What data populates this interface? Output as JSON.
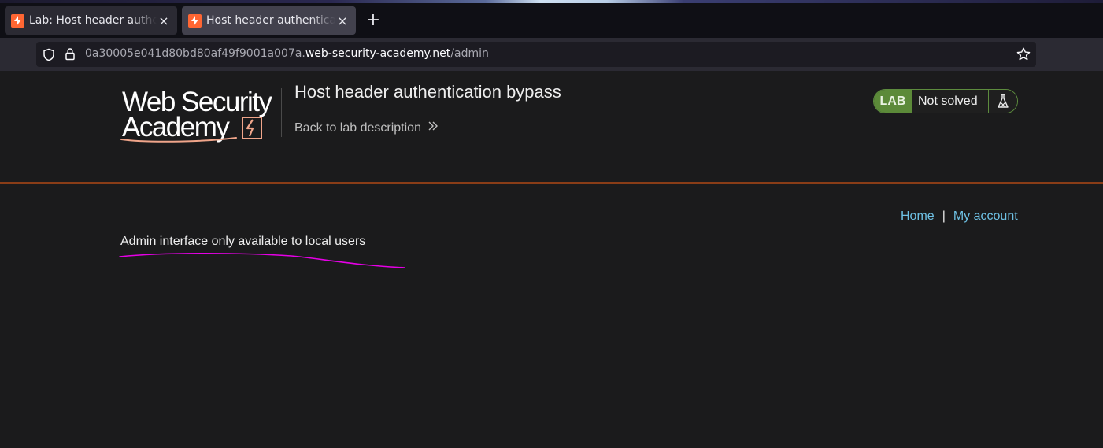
{
  "browser": {
    "tabs": [
      {
        "title": "Lab: Host header authentication bypass",
        "close": "×"
      },
      {
        "title": "Host header authentication bypass",
        "close": "×"
      }
    ],
    "new_tab": "+",
    "url": {
      "subdomain": "0a30005e041d80bd80af49f9001a007a.",
      "host": "web-security-academy.net",
      "path": "/admin"
    }
  },
  "header": {
    "logo_line1": "Web Security",
    "logo_line2": "Academy",
    "lab_title": "Host header authentication bypass",
    "back_link": "Back to lab description",
    "lab_badge": "LAB",
    "lab_status": "Not solved"
  },
  "nav": {
    "home": "Home",
    "separator": "|",
    "my_account": "My account"
  },
  "main": {
    "message": "Admin interface only available to local users"
  },
  "colors": {
    "accent": "#ff6633",
    "link": "#6ec1e4",
    "lab_green": "#5c8a39",
    "header_rule": "#8a3d17",
    "annotation": "#e600e6"
  }
}
